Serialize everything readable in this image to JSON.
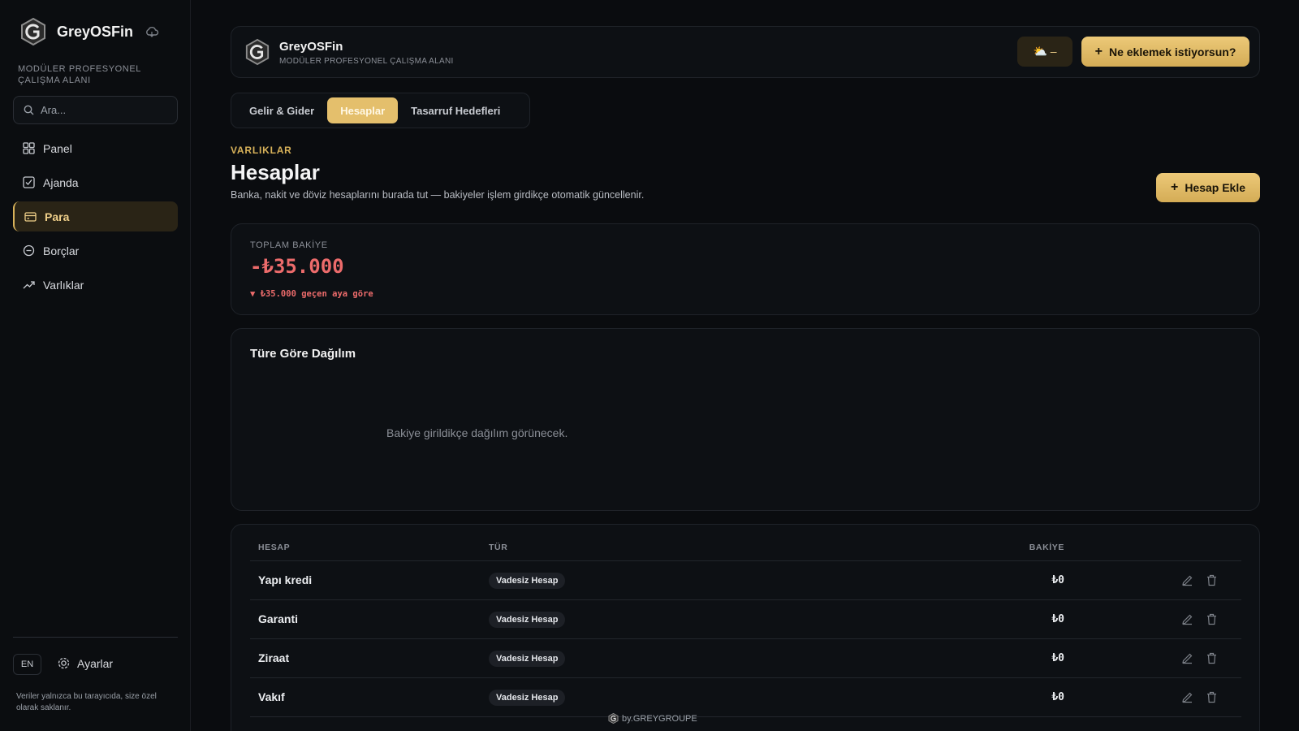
{
  "app": {
    "name": "GreyOSFin",
    "subtitle": "MODÜLER PROFESYONEL ÇALIŞMA ALANI",
    "accent_color": "#d8b25a",
    "negative_color": "#ec6b6b"
  },
  "sidebar": {
    "subtitle": "MODÜLER PROFESYONEL ÇALIŞMA ALANI",
    "search_placeholder": "Ara...",
    "items": [
      {
        "label": "Panel",
        "icon": "dashboard-icon"
      },
      {
        "label": "Ajanda",
        "icon": "checkbox-icon"
      },
      {
        "label": "Para",
        "icon": "wallet-icon",
        "active": true
      },
      {
        "label": "Borçlar",
        "icon": "circle-icon"
      },
      {
        "label": "Varlıklar",
        "icon": "trend-up-icon"
      }
    ],
    "lang": "EN",
    "settings_label": "Ayarlar",
    "note": "Veriler yalnızca bu tarayıcıda, size özel olarak saklanır."
  },
  "header": {
    "title": "GreyOSFin",
    "subtitle": "MODÜLER PROFESYONEL ÇALIŞMA ALANI",
    "weather": "⛅ –",
    "add_button": "Ne eklemek istiyorsun?"
  },
  "tabs": [
    {
      "label": "Gelir & Gider"
    },
    {
      "label": "Hesaplar",
      "active": true
    },
    {
      "label": "Tasarruf Hedefleri"
    }
  ],
  "page": {
    "eyebrow": "VARLIKLAR",
    "title": "Hesaplar",
    "description": "Banka, nakit ve döviz hesaplarını burada tut — bakiyeler işlem girdikçe otomatik güncellenir.",
    "add_button": "Hesap Ekle"
  },
  "balance": {
    "label": "TOPLAM BAKİYE",
    "value": "-₺35.000",
    "delta": "▼ ₺35.000 geçen aya göre"
  },
  "distribution": {
    "title": "Türe Göre Dağılım",
    "empty": "Bakiye girildikçe dağılım görünecek."
  },
  "table": {
    "columns": [
      "HESAP",
      "TÜR",
      "BAKİYE"
    ],
    "rows": [
      {
        "name": "Yapı kredi",
        "type": "Vadesiz Hesap",
        "balance": "₺0"
      },
      {
        "name": "Garanti",
        "type": "Vadesiz Hesap",
        "balance": "₺0"
      },
      {
        "name": "Ziraat",
        "type": "Vadesiz Hesap",
        "balance": "₺0"
      },
      {
        "name": "Vakıf",
        "type": "Vadesiz Hesap",
        "balance": "₺0"
      }
    ]
  },
  "footer": {
    "credit": "by.GREYGROUPE"
  }
}
